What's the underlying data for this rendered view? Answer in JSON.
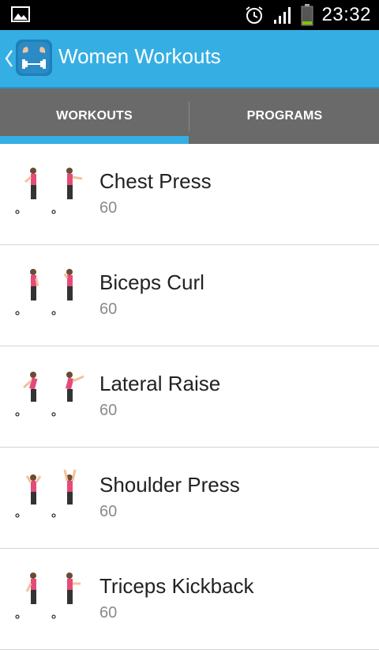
{
  "status_bar": {
    "time": "23:32",
    "icons": [
      "picture-icon",
      "alarm-icon",
      "signal-icon",
      "battery-icon"
    ]
  },
  "action_bar": {
    "title": "Women Workouts",
    "accent_color": "#35aee3"
  },
  "tabs": [
    {
      "label": "WORKOUTS",
      "selected": true
    },
    {
      "label": "PROGRAMS",
      "selected": false
    }
  ],
  "workouts": [
    {
      "name": "Chest Press",
      "value": "60"
    },
    {
      "name": "Biceps Curl",
      "value": "60"
    },
    {
      "name": "Lateral Raise",
      "value": "60"
    },
    {
      "name": "Shoulder Press",
      "value": "60"
    },
    {
      "name": "Triceps Kickback",
      "value": "60"
    }
  ]
}
